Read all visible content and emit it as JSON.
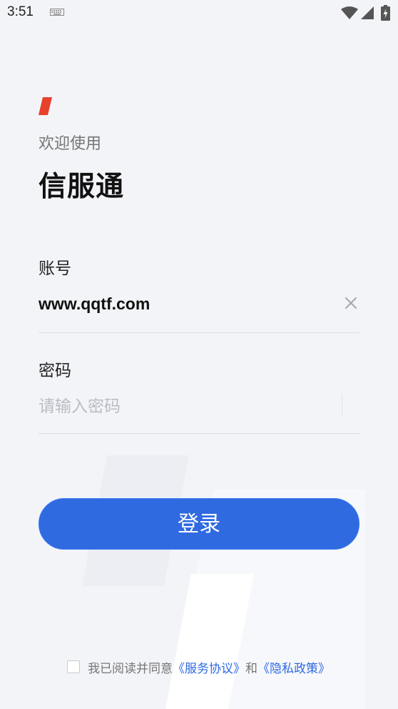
{
  "status_bar": {
    "time": "3:51",
    "icons": [
      "keyboard-icon",
      "wifi-icon",
      "signal-icon",
      "battery-icon"
    ]
  },
  "brand": {
    "welcome": "欢迎使用",
    "app_name": "信服通",
    "accent_color": "#e8412c"
  },
  "form": {
    "account_label": "账号",
    "account_value": "www.qqtf.com",
    "password_label": "密码",
    "password_placeholder": "请输入密码"
  },
  "login_button": {
    "label": "登录",
    "color": "#2f6ae1"
  },
  "agreement": {
    "prefix": "我已阅读并同意",
    "service_link": "《服务协议》",
    "conjunction": "和",
    "privacy_link": "《隐私政策》",
    "checked": false
  }
}
